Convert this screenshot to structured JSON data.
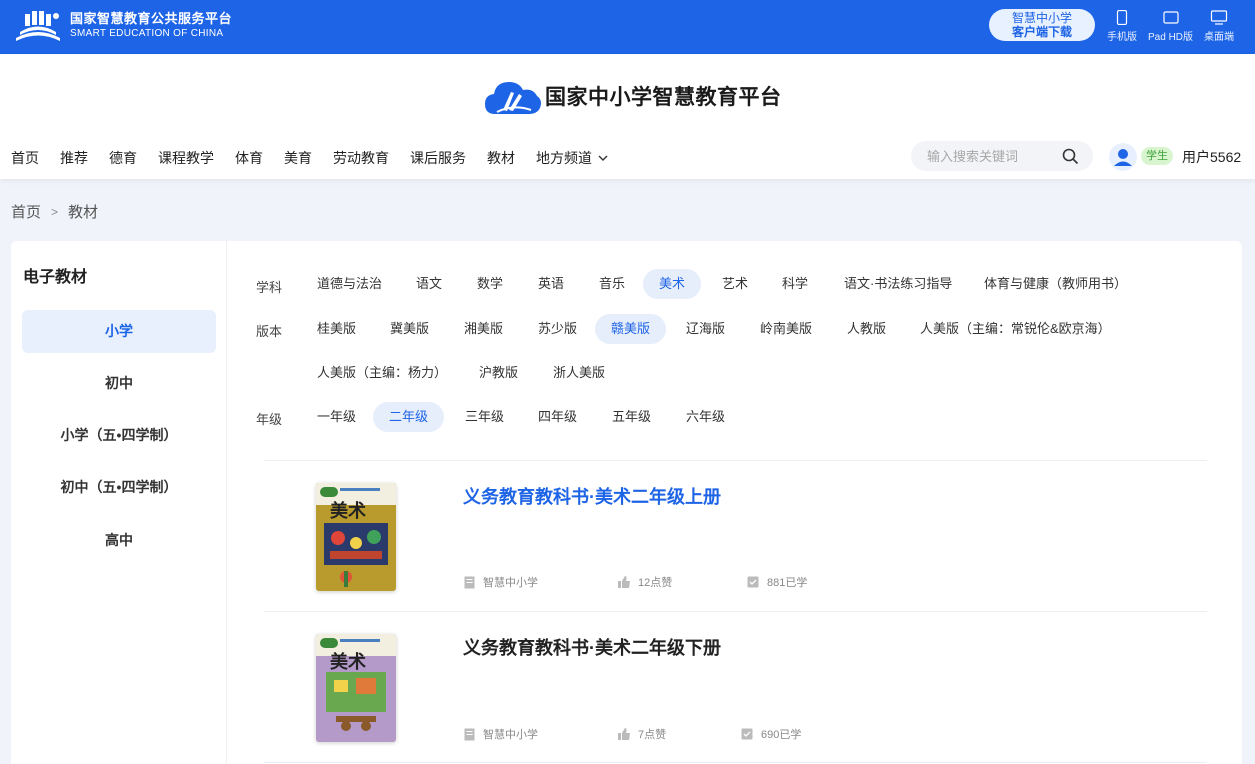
{
  "topbar": {
    "logo_cn": "国家智慧教育公共服务平台",
    "logo_en": "SMART EDUCATION OF CHINA",
    "download_line1": "智慧中小学",
    "download_line2": "客户端下载",
    "devices": [
      {
        "label": "手机版",
        "icon": "phone-icon"
      },
      {
        "label": "Pad HD版",
        "icon": "tablet-icon"
      },
      {
        "label": "桌面端",
        "icon": "desktop-icon"
      }
    ]
  },
  "header": {
    "brand_title": "国家中小学智慧教育平台",
    "nav": [
      "首页",
      "推荐",
      "德育",
      "课程教学",
      "体育",
      "美育",
      "劳动教育",
      "课后服务",
      "教材",
      "地方频道"
    ],
    "search_placeholder": "输入搜索关键词",
    "role_badge": "学生",
    "username": "用户5562"
  },
  "breadcrumb": {
    "home": "首页",
    "separator": ">",
    "current": "教材"
  },
  "sidebar": {
    "title": "电子教材",
    "items": [
      "小学",
      "初中",
      "小学（五•四学制）",
      "初中（五•四学制）",
      "高中"
    ],
    "active_index": 0
  },
  "filters": {
    "subject_label": "学科",
    "subjects": [
      "道德与法治",
      "语文",
      "数学",
      "英语",
      "音乐",
      "美术",
      "艺术",
      "科学",
      "语文·书法练习指导",
      "体育与健康（教师用书）"
    ],
    "subject_active": "美术",
    "edition_label": "版本",
    "editions": [
      "桂美版",
      "冀美版",
      "湘美版",
      "苏少版",
      "赣美版",
      "辽海版",
      "岭南美版",
      "人教版",
      "人美版（主编：常锐伦&欧京海）",
      "人美版（主编：杨力）",
      "沪教版",
      "浙人美版"
    ],
    "edition_active": "赣美版",
    "grade_label": "年级",
    "grades": [
      "一年级",
      "二年级",
      "三年级",
      "四年级",
      "五年级",
      "六年级"
    ],
    "grade_active": "二年级"
  },
  "books": [
    {
      "title": "义务教育教科书·美术二年级上册",
      "publisher": "智慧中小学",
      "likes": "12点赞",
      "learners": "881已学",
      "cover_text": "美术",
      "cover_color": "#b99a2c"
    },
    {
      "title": "义务教育教科书·美术二年级下册",
      "publisher": "智慧中小学",
      "likes": "7点赞",
      "learners": "690已学",
      "cover_text": "美术",
      "cover_color": "#b49ac9"
    }
  ],
  "colors": {
    "primary": "#1e64e6",
    "active_bg": "#e6eefc",
    "badge_green": "#3ea33a"
  }
}
